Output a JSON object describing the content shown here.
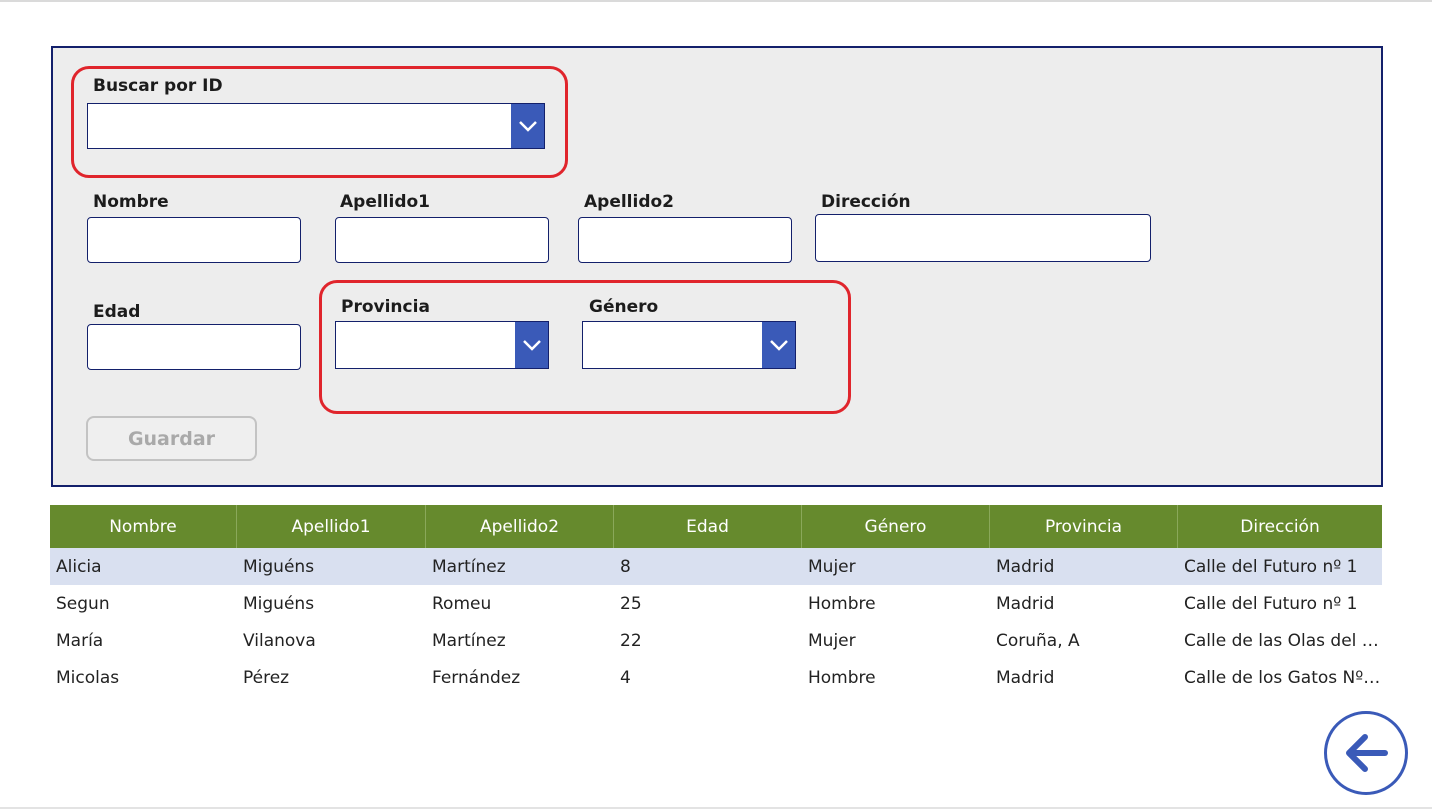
{
  "form": {
    "search_label": "Buscar por ID",
    "search_value": "",
    "nombre_label": "Nombre",
    "nombre_value": "",
    "apellido1_label": "Apellido1",
    "apellido1_value": "",
    "apellido2_label": "Apellido2",
    "apellido2_value": "",
    "direccion_label": "Dirección",
    "direccion_value": "",
    "edad_label": "Edad",
    "edad_value": "",
    "provincia_label": "Provincia",
    "provincia_value": "",
    "genero_label": "Género",
    "genero_value": "",
    "save_label": "Guardar"
  },
  "table": {
    "headers": [
      "Nombre",
      "Apellido1",
      "Apellido2",
      "Edad",
      "Género",
      "Provincia",
      "Dirección"
    ],
    "rows": [
      [
        "Alicia",
        "Miguéns",
        "Martínez",
        "8",
        "Mujer",
        "Madrid",
        "Calle del Futuro nº 1"
      ],
      [
        "Segun",
        "Miguéns",
        "Romeu",
        "25",
        "Hombre",
        "Madrid",
        "Calle del Futuro nº 1"
      ],
      [
        "María",
        "Vilanova",
        "Martínez",
        "22",
        "Mujer",
        "Coruña, A",
        "Calle de las Olas del …"
      ],
      [
        "Micolas",
        "Pérez",
        "Fernández",
        "4",
        "Hombre",
        "Madrid",
        "Calle de los Gatos Nº…"
      ]
    ]
  },
  "colors": {
    "panel_border": "#13206b",
    "highlight": "#e0252c",
    "header_green": "#668a2d",
    "selected_row": "#d9e0f0",
    "accent_blue": "#3a5ab8"
  },
  "icons": {
    "dropdown": "chevron-down-icon",
    "back": "arrow-left-icon"
  }
}
